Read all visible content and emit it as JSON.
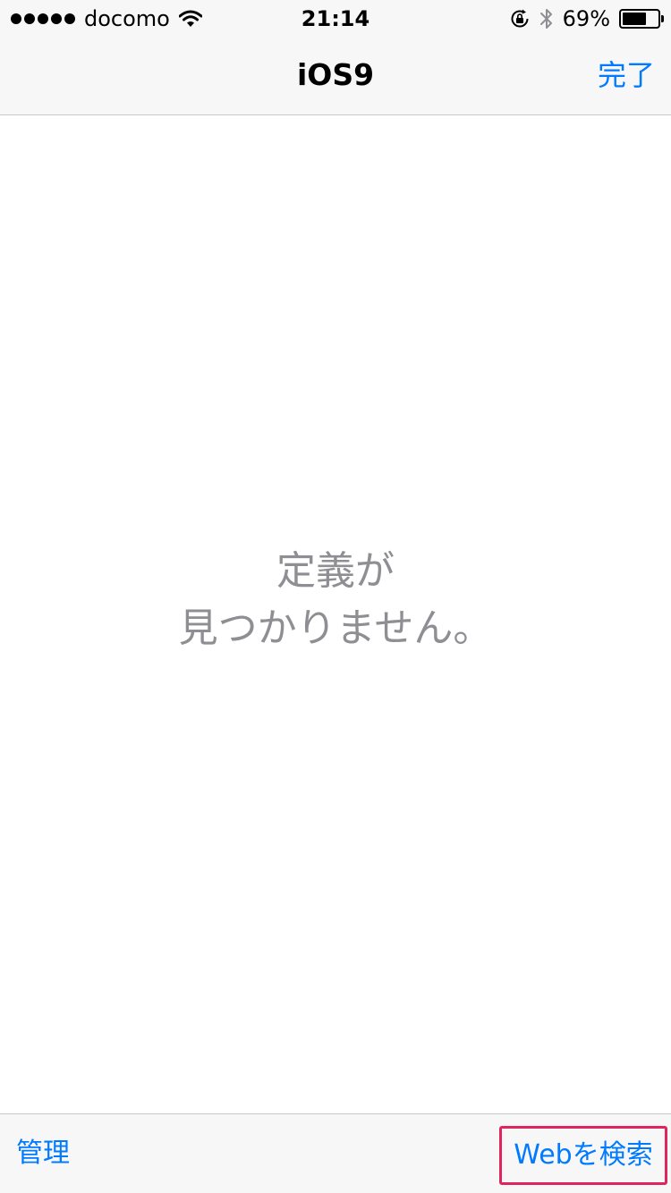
{
  "status_bar": {
    "carrier": "docomo",
    "time": "21:14",
    "battery_percent": "69%",
    "battery_level": 0.69,
    "signal_bars": 5,
    "icons": [
      "signal-dots-icon",
      "wifi-icon",
      "orientation-lock-icon",
      "bluetooth-icon",
      "battery-icon"
    ]
  },
  "navbar": {
    "title": "iOS9",
    "done_label": "完了"
  },
  "content": {
    "message_line1": "定義が",
    "message_line2": "見つかりません。"
  },
  "toolbar": {
    "manage_label": "管理",
    "search_web_label": "Webを検索"
  },
  "colors": {
    "accent": "#007aff",
    "muted_text": "#8e8e93",
    "bar_background": "#f7f7f7",
    "highlight_border": "#e0245e"
  }
}
